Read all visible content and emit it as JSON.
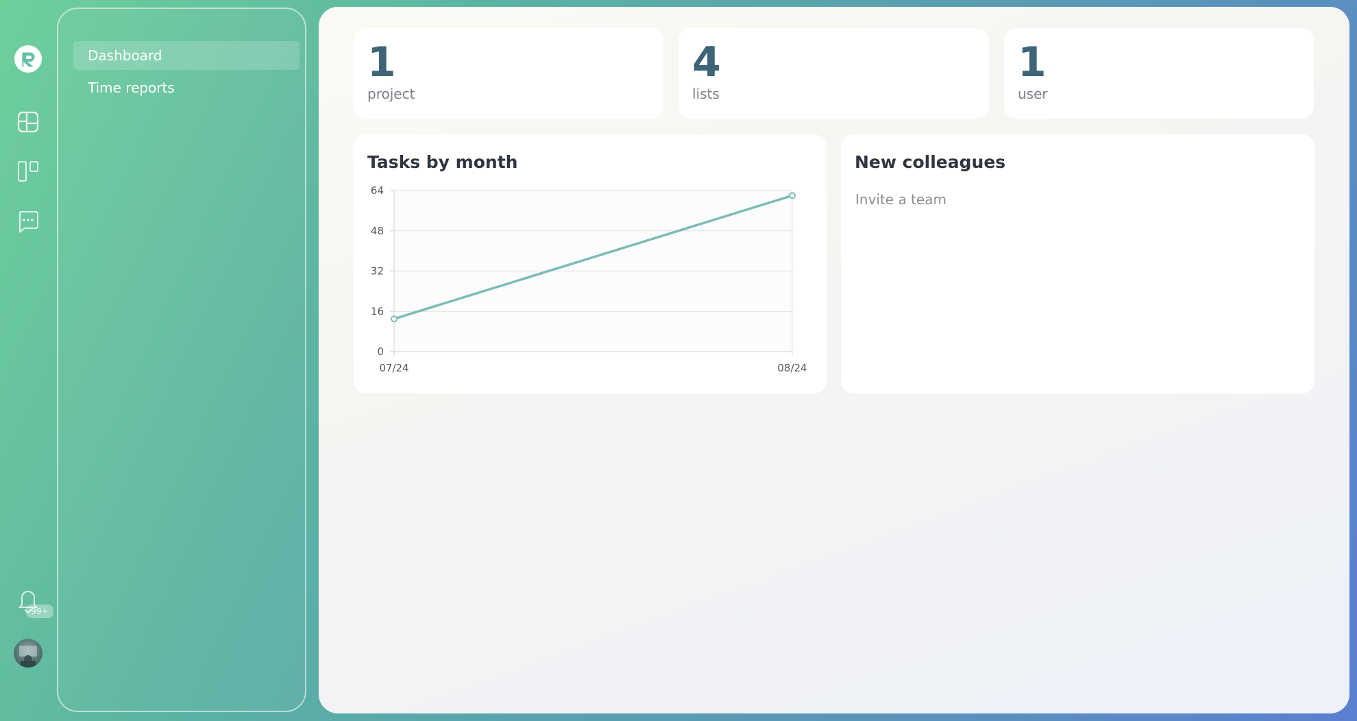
{
  "sidebar": {
    "items": [
      {
        "label": "Dashboard",
        "active": true
      },
      {
        "label": "Time reports",
        "active": false
      }
    ]
  },
  "rail": {
    "icons": [
      "logo-icon",
      "dashboard-icon",
      "board-icon",
      "chat-icon",
      "bell-icon"
    ],
    "notification_badge": "99+"
  },
  "stats": [
    {
      "value": "1",
      "label": "project"
    },
    {
      "value": "4",
      "label": "lists"
    },
    {
      "value": "1",
      "label": "user"
    }
  ],
  "chart": {
    "title": "Tasks by month"
  },
  "chart_data": {
    "type": "line",
    "title": "Tasks by month",
    "categories": [
      "07/24",
      "08/24"
    ],
    "series": [
      {
        "values": [
          13,
          62
        ]
      }
    ],
    "ylim": [
      0,
      64
    ],
    "yticks": [
      0,
      16,
      32,
      48,
      64
    ],
    "grid": true,
    "xlabel": "",
    "ylabel": "",
    "color": "#7bbab9"
  },
  "colleagues": {
    "title": "New colleagues",
    "invite_text": "Invite a team"
  },
  "colors": {
    "accent": "#3d6477",
    "line": "#7bbab9"
  }
}
